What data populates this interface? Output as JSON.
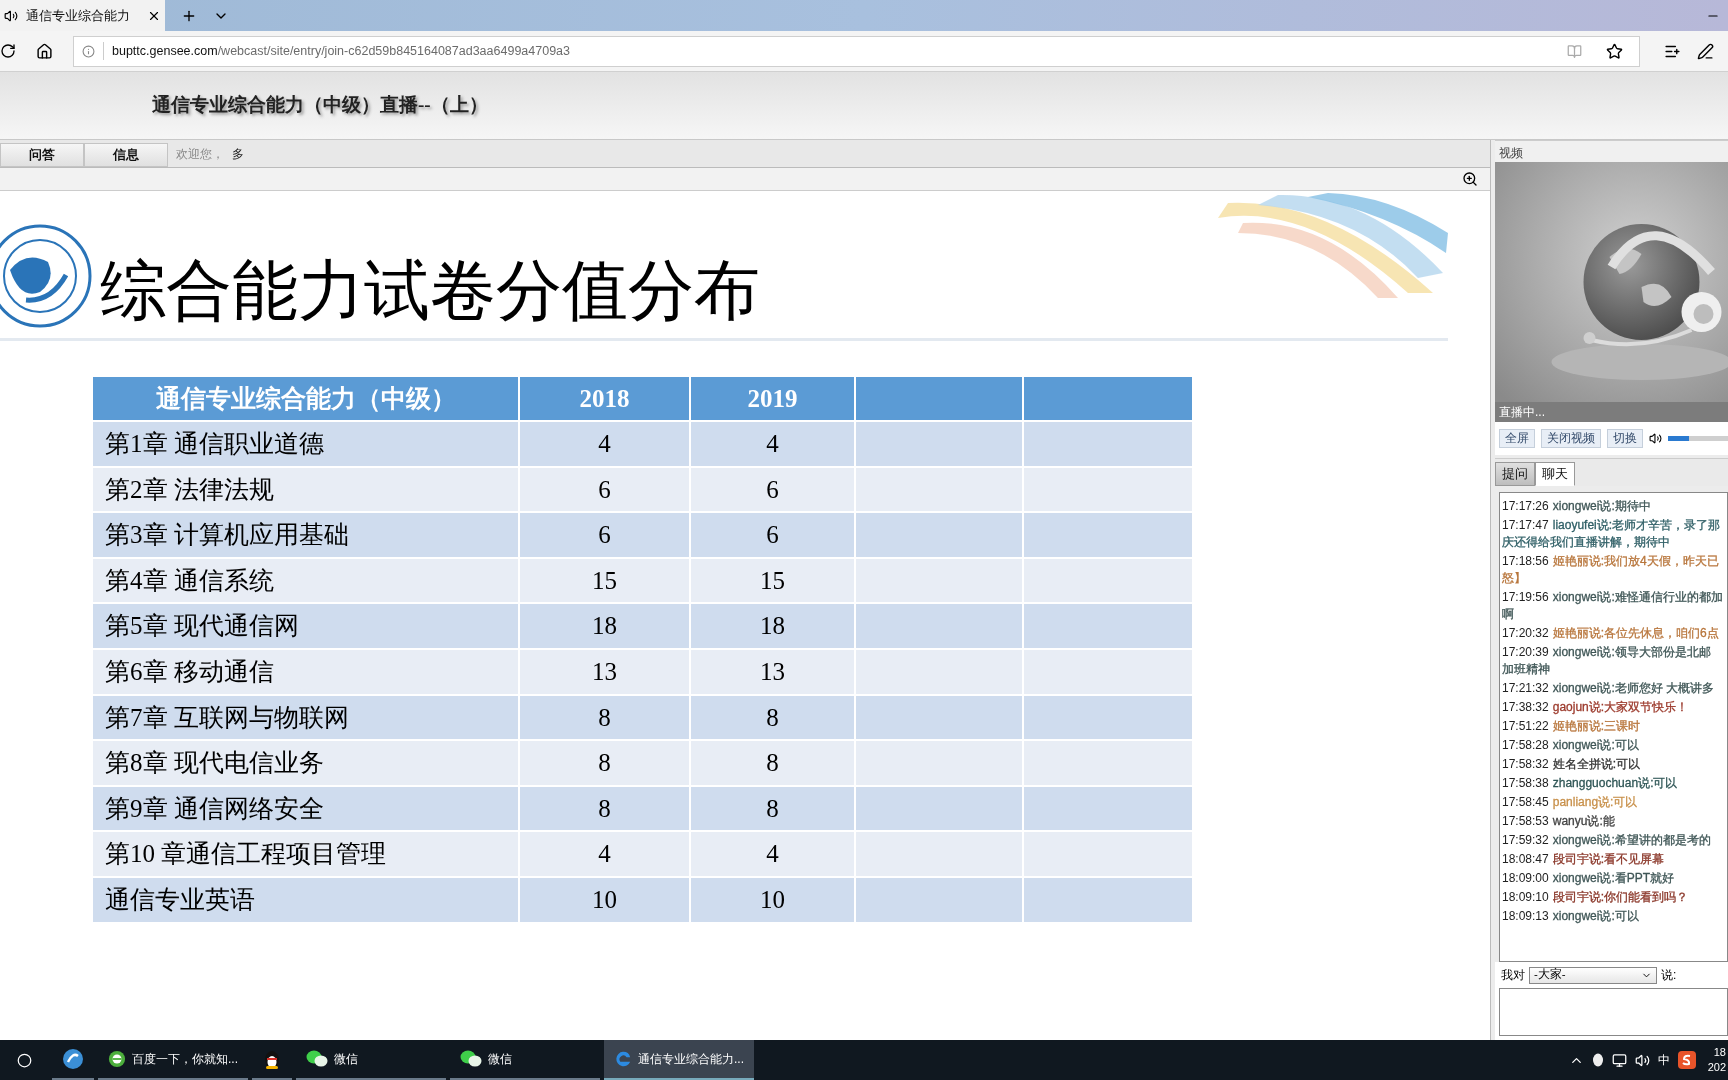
{
  "browser": {
    "tab_title": "通信专业综合能力",
    "url_host": "bupttc.gensee.com",
    "url_path": "/webcast/site/entry/join-c62d59b845164087ad3aa6499a4709a3"
  },
  "page_header": {
    "title": "通信专业综合能力（中级）直播--（上）"
  },
  "nav": {
    "tabs": [
      {
        "label": "问答"
      },
      {
        "label": "信息"
      }
    ],
    "welcome": "欢迎您，",
    "user": "多"
  },
  "slide": {
    "title": "综合能力试卷分值分布",
    "table": {
      "columns": [
        "通信专业综合能力（中级）",
        "2018",
        "2019"
      ],
      "rows": [
        [
          "第1章 通信职业道德",
          "4",
          "4"
        ],
        [
          "第2章 法律法规",
          "6",
          "6"
        ],
        [
          "第3章 计算机应用基础",
          "6",
          "6"
        ],
        [
          "第4章 通信系统",
          "15",
          "15"
        ],
        [
          "第5章 现代通信网",
          "18",
          "18"
        ],
        [
          "第6章 移动通信",
          "13",
          "13"
        ],
        [
          "第7章 互联网与物联网",
          "8",
          "8"
        ],
        [
          "第8章 现代电信业务",
          "8",
          "8"
        ],
        [
          "第9章 通信网络安全",
          "8",
          "8"
        ],
        [
          "第10 章通信工程项目管理",
          "4",
          "4"
        ],
        [
          "通信专业英语",
          "10",
          "10"
        ]
      ]
    }
  },
  "video_panel": {
    "label": "视频",
    "status": "直播中...",
    "buttons": [
      "全屏",
      "关闭视频",
      "切换"
    ],
    "volume": {
      "level": 0.35
    },
    "tabs": [
      {
        "label": "提问",
        "selected": false
      },
      {
        "label": "聊天",
        "selected": true
      }
    ]
  },
  "chat": {
    "messages": [
      {
        "time": "17:17:26",
        "lines": [
          "xiongwei说:期待中"
        ],
        "color": "#3f5656"
      },
      {
        "time": "17:17:47",
        "lines": [
          "liaoyufei说:老师才辛苦，录了那",
          "庆还得给我们直播讲解，期待中"
        ],
        "color": "#2f5f66"
      },
      {
        "time": "17:18:56",
        "lines": [
          "姬艳丽说:我们放4天假，昨天已",
          "怒】"
        ],
        "color": "#b8763c"
      },
      {
        "time": "17:19:56",
        "lines": [
          "xiongwei说:难怪通信行业的都加",
          "啊"
        ],
        "color": "#3f5656"
      },
      {
        "time": "17:20:32",
        "lines": [
          "姬艳丽说:各位先休息，咱们6点"
        ],
        "color": "#b8763c"
      },
      {
        "time": "17:20:39",
        "lines": [
          "xiongwei说:领导大部份是北邮",
          "加班精神"
        ],
        "color": "#3f5656"
      },
      {
        "time": "17:21:32",
        "lines": [
          "xiongwei说:老师您好 大概讲多"
        ],
        "color": "#3f5656"
      },
      {
        "time": "17:38:32",
        "lines": [
          "gaojun说:大家双节快乐！"
        ],
        "color": "#9c3a2c"
      },
      {
        "time": "17:51:22",
        "lines": [
          "姬艳丽说:三课时"
        ],
        "color": "#b8763c"
      },
      {
        "time": "17:58:28",
        "lines": [
          "xiongwei说:可以"
        ],
        "color": "#3f5656"
      },
      {
        "time": "17:58:32",
        "lines": [
          "姓名全拼说:可以"
        ],
        "color": "#333333"
      },
      {
        "time": "17:58:38",
        "lines": [
          "zhangguochuan说:可以"
        ],
        "color": "#2f5656"
      },
      {
        "time": "17:58:45",
        "lines": [
          "panliang说:可以"
        ],
        "color": "#c8904a"
      },
      {
        "time": "17:58:53",
        "lines": [
          "wanyu说:能"
        ],
        "color": "#444444"
      },
      {
        "time": "17:59:32",
        "lines": [
          "xiongwei说:希望讲的都是考的"
        ],
        "color": "#3f5656"
      },
      {
        "time": "18:08:47",
        "lines": [
          "段司宇说:看不见屏幕"
        ],
        "color": "#8a3628"
      },
      {
        "time": "18:09:00",
        "lines": [
          "xiongwei说:看PPT就好"
        ],
        "color": "#3f5656"
      },
      {
        "time": "18:09:10",
        "lines": [
          "段司宇说:你们能看到吗？"
        ],
        "color": "#8a3628"
      },
      {
        "time": "18:09:13",
        "lines": [
          "xiongwei说:可以"
        ],
        "color": "#3f5656"
      }
    ]
  },
  "composer": {
    "label": "我对",
    "recipient": "-大家-",
    "suffix": "说:"
  },
  "taskbar": {
    "items": [
      {
        "kind": "sogou",
        "selected": false
      },
      {
        "kind": "browser",
        "label": "百度一下，你就知...",
        "selected": false
      },
      {
        "kind": "qq",
        "selected": false
      },
      {
        "kind": "wechat",
        "label": "微信",
        "selected": false
      },
      {
        "kind": "wechat",
        "label": "微信",
        "selected": false
      },
      {
        "kind": "edge",
        "label": "通信专业综合能力...",
        "selected": true
      }
    ],
    "ime": "中",
    "clock": [
      "18",
      "202"
    ]
  }
}
